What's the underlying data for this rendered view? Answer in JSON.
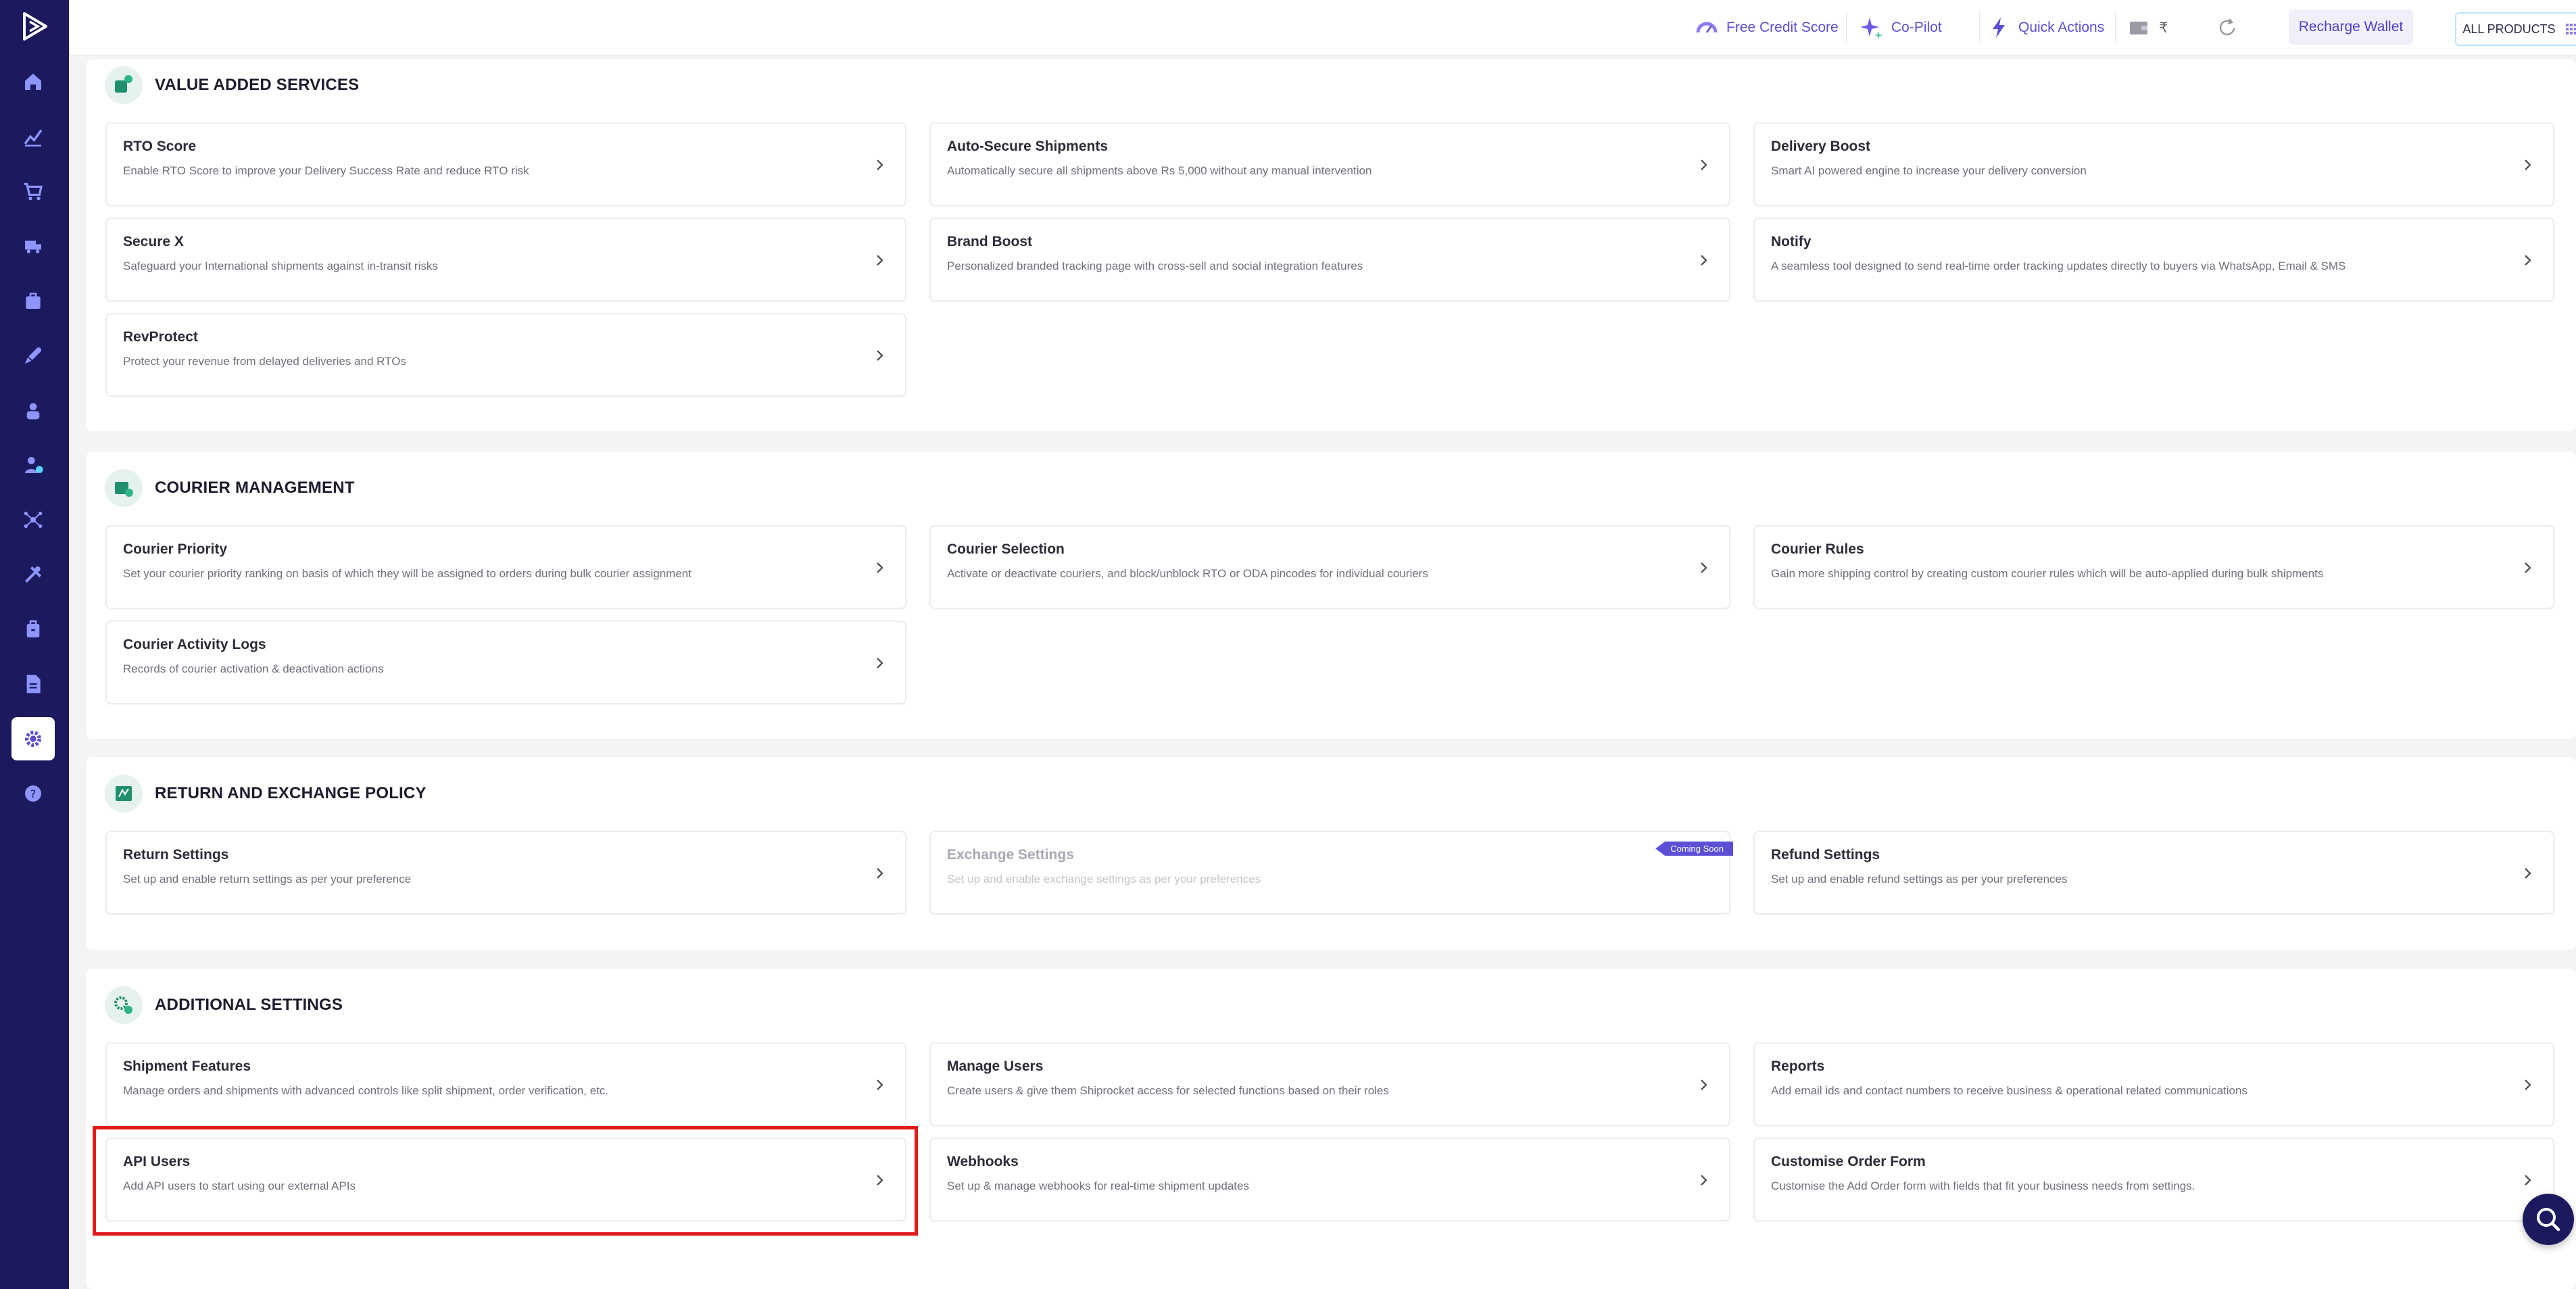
{
  "topbar": {
    "free_credit": "Free Credit Score",
    "copilot": "Co-Pilot",
    "quick_actions": "Quick Actions",
    "wallet_amount": "₹",
    "recharge": "Recharge Wallet",
    "all_products": "ALL PRODUCTS"
  },
  "sidebar": {
    "items": [
      "home-icon",
      "analytics-icon",
      "orders-icon",
      "shipments-icon",
      "returns-icon",
      "rocket-icon",
      "buyer-icon",
      "user-check-icon",
      "integrations-icon",
      "tools-icon",
      "billing-icon",
      "reports-icon",
      "settings-icon",
      "help-icon"
    ],
    "active": "settings-icon"
  },
  "sections": {
    "value_added": {
      "title": "VALUE ADDED SERVICES",
      "cards": [
        {
          "title": "RTO Score",
          "desc": "Enable RTO Score to improve your Delivery Success Rate and reduce RTO risk"
        },
        {
          "title": "Auto-Secure Shipments",
          "desc": "Automatically secure all shipments above Rs 5,000 without any manual intervention"
        },
        {
          "title": "Delivery Boost",
          "desc": "Smart AI powered engine to increase your delivery conversion"
        },
        {
          "title": "Secure X",
          "desc": "Safeguard your International shipments against in-transit risks"
        },
        {
          "title": "Brand Boost",
          "desc": "Personalized branded tracking page with cross-sell and social integration features"
        },
        {
          "title": "Notify",
          "desc": "A seamless tool designed to send real-time order tracking updates directly to buyers via WhatsApp, Email & SMS"
        },
        {
          "title": "RevProtect",
          "desc": "Protect your revenue from delayed deliveries and RTOs"
        }
      ]
    },
    "courier": {
      "title": "COURIER MANAGEMENT",
      "cards": [
        {
          "title": "Courier Priority",
          "desc": "Set your courier priority ranking on basis of which they will be assigned to orders during bulk courier assignment"
        },
        {
          "title": "Courier Selection",
          "desc": "Activate or deactivate couriers, and block/unblock RTO or ODA pincodes for individual couriers"
        },
        {
          "title": "Courier Rules",
          "desc": "Gain more shipping control by creating custom courier rules which will be auto-applied during bulk shipments"
        },
        {
          "title": "Courier Activity Logs",
          "desc": "Records of courier activation & deactivation actions"
        }
      ]
    },
    "returns": {
      "title": "RETURN AND EXCHANGE POLICY",
      "cards": [
        {
          "title": "Return Settings",
          "desc": "Set up and enable return settings as per your preference"
        },
        {
          "title": "Exchange Settings",
          "desc": "Set up and enable exchange settings as per your preferences",
          "badge": "Coming Soon"
        },
        {
          "title": "Refund Settings",
          "desc": "Set up and enable refund settings as per your preferences"
        }
      ]
    },
    "additional": {
      "title": "ADDITIONAL SETTINGS",
      "cards": [
        {
          "title": "Shipment Features",
          "desc": "Manage orders and shipments with advanced controls like split shipment, order verification, etc."
        },
        {
          "title": "Manage Users",
          "desc": "Create users & give them Shiprocket access for selected functions based on their roles"
        },
        {
          "title": "Reports",
          "desc": "Add email ids and contact numbers to receive business & operational related communications"
        },
        {
          "title": "API Users",
          "desc": "Add API users to start using our external APIs"
        },
        {
          "title": "Webhooks",
          "desc": "Set up & manage webhooks for real-time shipment updates"
        },
        {
          "title": "Customise Order Form",
          "desc": "Customise the Add Order form with fields that fit your business needs from settings."
        }
      ]
    }
  },
  "colors": {
    "sidebar": "#1b1a5e",
    "accent": "#5b4fd6",
    "teal": "#1f8f6e",
    "highlight": "#e11b1b"
  }
}
